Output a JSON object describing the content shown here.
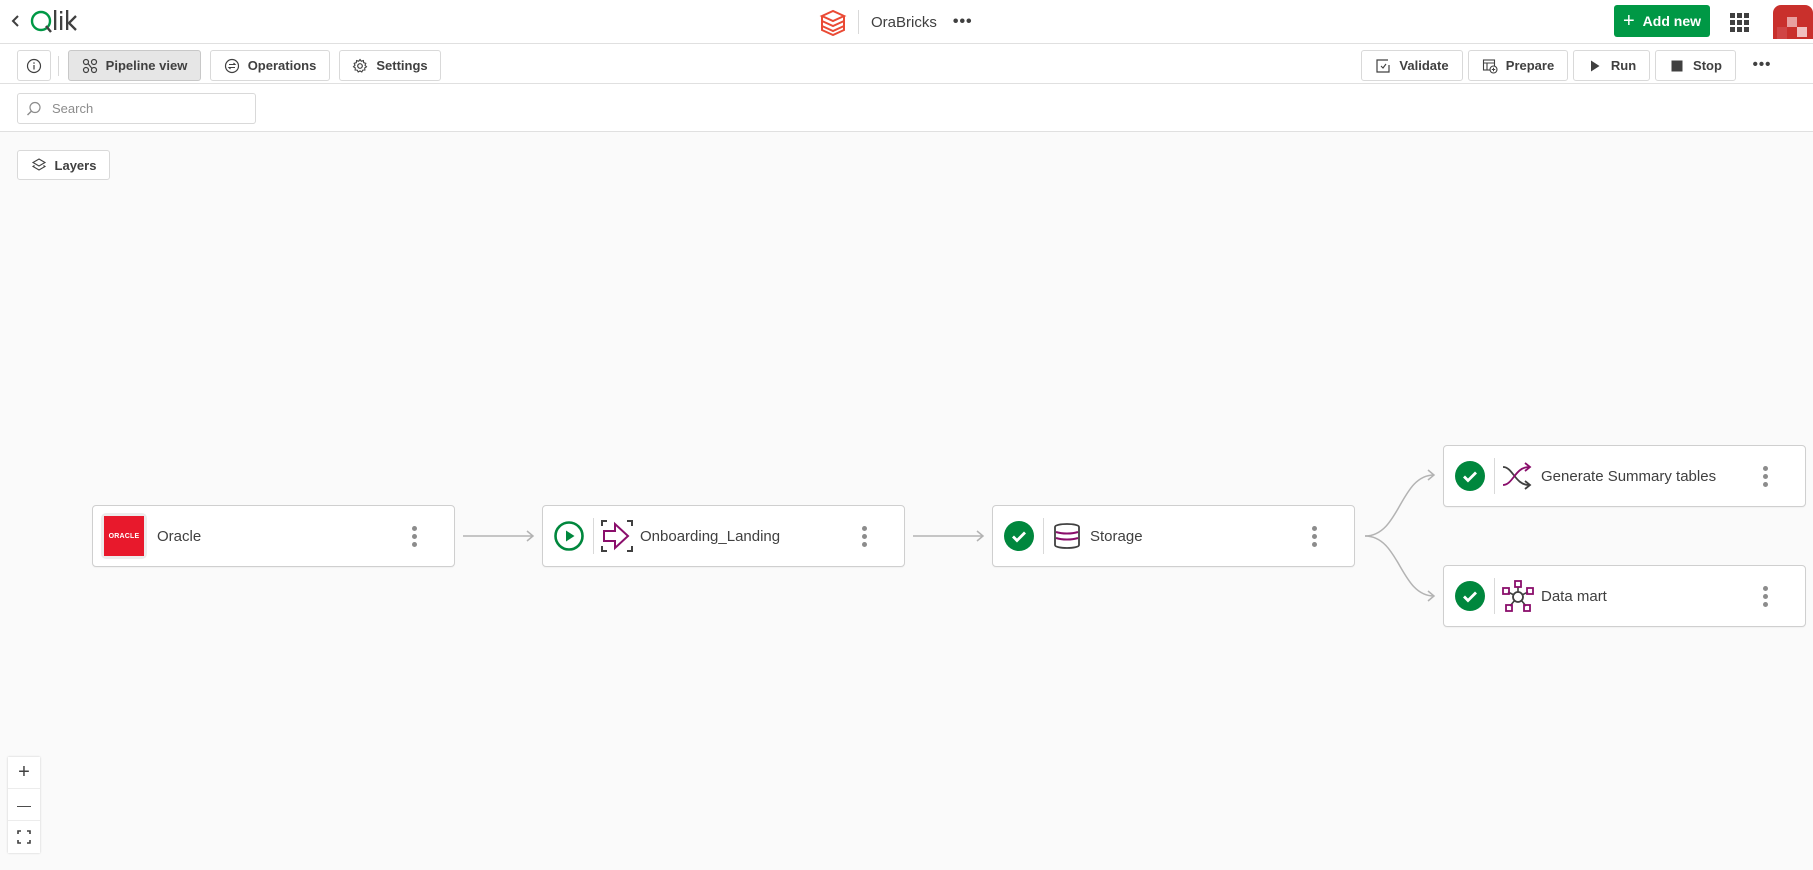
{
  "header": {
    "brand": "Qlik",
    "app_title": "OraBricks",
    "more_label": "•••",
    "add_new_label": "Add new"
  },
  "toolbar": {
    "tabs": [
      {
        "label": "Pipeline view",
        "icon": "pipeline-icon",
        "active": true
      },
      {
        "label": "Operations",
        "icon": "operations-icon",
        "active": false
      },
      {
        "label": "Settings",
        "icon": "gear-icon",
        "active": false
      }
    ],
    "actions": [
      {
        "label": "Validate",
        "icon": "validate-icon"
      },
      {
        "label": "Prepare",
        "icon": "prepare-icon"
      },
      {
        "label": "Run",
        "icon": "play-icon"
      },
      {
        "label": "Stop",
        "icon": "stop-icon"
      }
    ],
    "more_label": "•••"
  },
  "search": {
    "placeholder": "Search",
    "value": ""
  },
  "canvas": {
    "layers_label": "Layers",
    "nodes": [
      {
        "id": "oracle",
        "label": "Oracle",
        "type": "source",
        "logo_text": "ORACLE",
        "status": null
      },
      {
        "id": "onboarding",
        "label": "Onboarding_Landing",
        "type": "landing",
        "status": "runnable"
      },
      {
        "id": "storage",
        "label": "Storage",
        "type": "storage",
        "status": "completed"
      },
      {
        "id": "summary",
        "label": "Generate Summary tables",
        "type": "transform",
        "status": "completed"
      },
      {
        "id": "datamart",
        "label": "Data mart",
        "type": "data-mart",
        "status": "completed"
      }
    ],
    "edges": [
      {
        "from": "oracle",
        "to": "onboarding"
      },
      {
        "from": "onboarding",
        "to": "storage"
      },
      {
        "from": "storage",
        "to": "summary"
      },
      {
        "from": "storage",
        "to": "datamart"
      }
    ]
  },
  "zoom_controls": {
    "zoom_in": "+",
    "zoom_out": "—"
  },
  "colors": {
    "brand_green": "#009845",
    "accent_purple": "#8a0e6b",
    "oracle_red": "#e8192c",
    "databricks_red": "#ea4a35"
  }
}
